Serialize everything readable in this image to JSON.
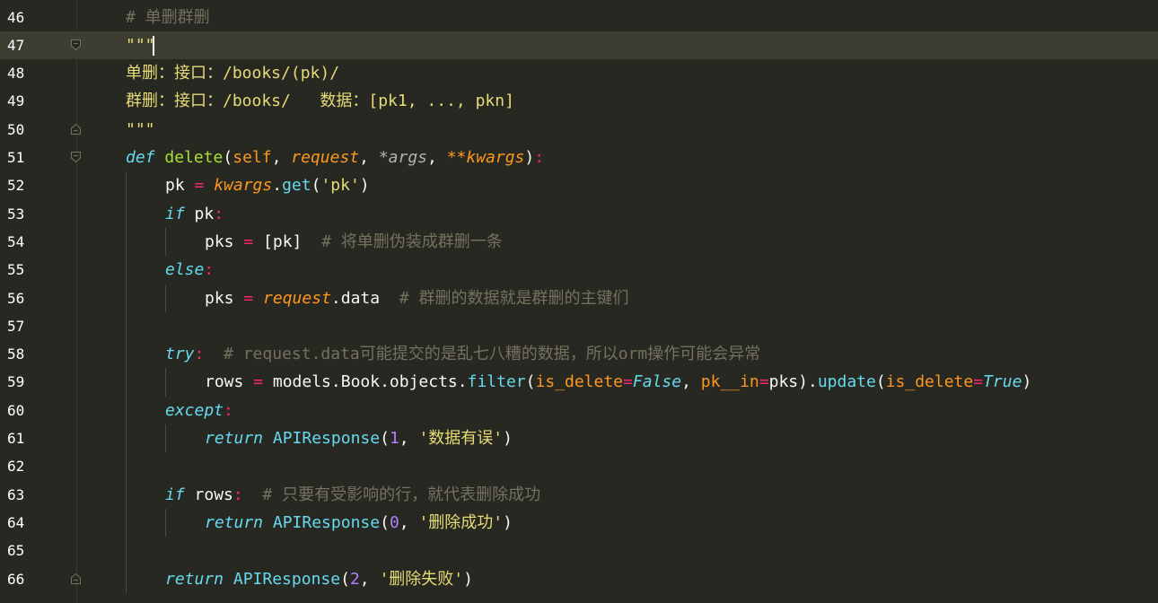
{
  "editor": {
    "current_line": "47",
    "lines": [
      {
        "num": "46",
        "indent": 0,
        "tokens": [
          [
            "comment",
            "# 单删群删"
          ]
        ]
      },
      {
        "num": "47",
        "indent": 0,
        "current": true,
        "fold": "start",
        "tokens": [
          [
            "doc",
            "\"\"\""
          ]
        ]
      },
      {
        "num": "48",
        "indent": 0,
        "tokens": [
          [
            "doc",
            "单删：接口：/books/(pk)/"
          ]
        ]
      },
      {
        "num": "49",
        "indent": 0,
        "tokens": [
          [
            "doc",
            "群删：接口：/books/   数据：[pk1, ..., pkn]"
          ]
        ]
      },
      {
        "num": "50",
        "indent": 0,
        "fold": "end",
        "tokens": [
          [
            "doc",
            "\"\"\""
          ]
        ]
      },
      {
        "num": "51",
        "indent": 0,
        "fold": "start",
        "tokens": [
          [
            "kw",
            "def"
          ],
          [
            "plain",
            " "
          ],
          [
            "fn",
            "delete"
          ],
          [
            "plain",
            "("
          ],
          [
            "self",
            "self"
          ],
          [
            "plain",
            ", "
          ],
          [
            "param",
            "request"
          ],
          [
            "plain",
            ", "
          ],
          [
            "args",
            "*args"
          ],
          [
            "plain",
            ", "
          ],
          [
            "param",
            "**kwargs"
          ],
          [
            "plain",
            ")"
          ],
          [
            "op",
            ":"
          ]
        ]
      },
      {
        "num": "52",
        "indent": 1,
        "tokens": [
          [
            "plain",
            "pk "
          ],
          [
            "op",
            "="
          ],
          [
            "plain",
            " "
          ],
          [
            "param",
            "kwargs"
          ],
          [
            "plain",
            "."
          ],
          [
            "call",
            "get"
          ],
          [
            "plain",
            "("
          ],
          [
            "str",
            "'pk'"
          ],
          [
            "plain",
            ")"
          ]
        ]
      },
      {
        "num": "53",
        "indent": 1,
        "tokens": [
          [
            "kw",
            "if"
          ],
          [
            "plain",
            " pk"
          ],
          [
            "op",
            ":"
          ]
        ]
      },
      {
        "num": "54",
        "indent": 2,
        "tokens": [
          [
            "plain",
            "pks "
          ],
          [
            "op",
            "="
          ],
          [
            "plain",
            " [pk]  "
          ],
          [
            "comment",
            "# 将单删伪装成群删一条"
          ]
        ]
      },
      {
        "num": "55",
        "indent": 1,
        "tokens": [
          [
            "kw",
            "else"
          ],
          [
            "op",
            ":"
          ]
        ]
      },
      {
        "num": "56",
        "indent": 2,
        "tokens": [
          [
            "plain",
            "pks "
          ],
          [
            "op",
            "="
          ],
          [
            "plain",
            " "
          ],
          [
            "param",
            "request"
          ],
          [
            "plain",
            ".data  "
          ],
          [
            "comment",
            "# 群删的数据就是群删的主键们"
          ]
        ]
      },
      {
        "num": "57",
        "indent": 0,
        "tokens": []
      },
      {
        "num": "58",
        "indent": 1,
        "tokens": [
          [
            "kw",
            "try"
          ],
          [
            "op",
            ":"
          ],
          [
            "plain",
            "  "
          ],
          [
            "comment",
            "# request.data可能提交的是乱七八糟的数据，所以orm操作可能会异常"
          ]
        ]
      },
      {
        "num": "59",
        "indent": 2,
        "tokens": [
          [
            "plain",
            "rows "
          ],
          [
            "op",
            "="
          ],
          [
            "plain",
            " models.Book.objects."
          ],
          [
            "call",
            "filter"
          ],
          [
            "plain",
            "("
          ],
          [
            "kwarg",
            "is_delete"
          ],
          [
            "op",
            "="
          ],
          [
            "const",
            "False"
          ],
          [
            "plain",
            ", "
          ],
          [
            "kwarg",
            "pk__in"
          ],
          [
            "op",
            "="
          ],
          [
            "plain",
            "pks)."
          ],
          [
            "call",
            "update"
          ],
          [
            "plain",
            "("
          ],
          [
            "kwarg",
            "is_delete"
          ],
          [
            "op",
            "="
          ],
          [
            "const",
            "True"
          ],
          [
            "plain",
            ")"
          ]
        ]
      },
      {
        "num": "60",
        "indent": 1,
        "tokens": [
          [
            "kw",
            "except"
          ],
          [
            "op",
            ":"
          ]
        ]
      },
      {
        "num": "61",
        "indent": 2,
        "tokens": [
          [
            "kw",
            "return"
          ],
          [
            "plain",
            " "
          ],
          [
            "call",
            "APIResponse"
          ],
          [
            "plain",
            "("
          ],
          [
            "num",
            "1"
          ],
          [
            "plain",
            ", "
          ],
          [
            "str",
            "'数据有误'"
          ],
          [
            "plain",
            ")"
          ]
        ]
      },
      {
        "num": "62",
        "indent": 0,
        "tokens": []
      },
      {
        "num": "63",
        "indent": 1,
        "tokens": [
          [
            "kw",
            "if"
          ],
          [
            "plain",
            " rows"
          ],
          [
            "op",
            ":"
          ],
          [
            "plain",
            "  "
          ],
          [
            "comment",
            "# 只要有受影响的行，就代表删除成功"
          ]
        ]
      },
      {
        "num": "64",
        "indent": 2,
        "tokens": [
          [
            "kw",
            "return"
          ],
          [
            "plain",
            " "
          ],
          [
            "call",
            "APIResponse"
          ],
          [
            "plain",
            "("
          ],
          [
            "num",
            "0"
          ],
          [
            "plain",
            ", "
          ],
          [
            "str",
            "'删除成功'"
          ],
          [
            "plain",
            ")"
          ]
        ]
      },
      {
        "num": "65",
        "indent": 0,
        "tokens": []
      },
      {
        "num": "66",
        "indent": 1,
        "fold": "end",
        "tokens": [
          [
            "kw",
            "return"
          ],
          [
            "plain",
            " "
          ],
          [
            "call",
            "APIResponse"
          ],
          [
            "plain",
            "("
          ],
          [
            "num",
            "2"
          ],
          [
            "plain",
            ", "
          ],
          [
            "str",
            "'删除失败'"
          ],
          [
            "plain",
            ")"
          ]
        ]
      }
    ]
  }
}
